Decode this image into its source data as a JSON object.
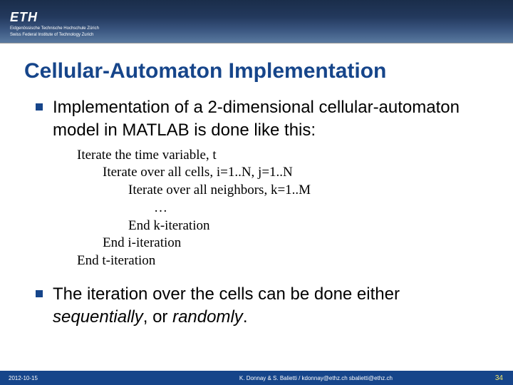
{
  "header": {
    "logo": "ETH",
    "subline1": "Eidgenössische Technische Hochschule Zürich",
    "subline2": "Swiss Federal Institute of Technology Zurich"
  },
  "title": "Cellular-Automaton Implementation",
  "bullets": {
    "b1": "Implementation of a 2-dimensional cellular-automaton model in MATLAB is done like this:",
    "b2_pre": "The iteration over the cells can be done either ",
    "b2_seq": "sequentially",
    "b2_mid": ", or ",
    "b2_rand": "randomly",
    "b2_end": "."
  },
  "pseudo": {
    "l1": "Iterate the time variable, t",
    "l2": "Iterate over all cells, i=1..N, j=1..N",
    "l3": "Iterate over all neighbors, k=1..M",
    "l4": "…",
    "l5": "End k-iteration",
    "l6": "End i-iteration",
    "l7": "End t-iteration"
  },
  "footer": {
    "date": "2012-10-15",
    "authors": "K. Donnay & S. Balietti / kdonnay@ethz.ch   sbalietti@ethz.ch",
    "page": "34"
  }
}
